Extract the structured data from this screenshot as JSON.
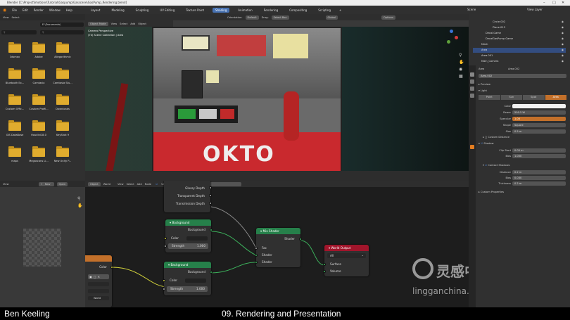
{
  "window": {
    "title": "Blender [C:\\Project\\Imotions\\Tutorial\\Gaspump\\Gasscene\\GasPump_Rendering.blend]"
  },
  "menu": [
    "File",
    "Edit",
    "Render",
    "Window",
    "Help"
  ],
  "workspaces": [
    "Layout",
    "Modeling",
    "Sculpting",
    "UV Editing",
    "Texture Paint",
    "Shading",
    "Animation",
    "Rendering",
    "Compositing",
    "Scripting"
  ],
  "active_workspace": "Shading",
  "scene": {
    "scene_label": "Scene",
    "view_layer_label": "View Layer"
  },
  "file_browser": {
    "menu": [
      "View",
      "Select"
    ],
    "path": "E:\\Documents\\",
    "folders": [
      "3dsmax",
      "Adobe",
      "Allegorithmic",
      "Bluetooth Ex...",
      "Camtasia",
      "Camtasia Stu...",
      "Custom Offic...",
      "Custom Profil...",
      "Downloads",
      "GIS DataBase",
      "Houdini18.0",
      "KeyShot 9",
      "maps",
      "Megascans Li...",
      "New Unity P..."
    ]
  },
  "viewport": {
    "header": [
      "Object Mode",
      "View",
      "Select",
      "Add",
      "Object"
    ],
    "orientation_label": "Orientation:",
    "orientation_value": "Default",
    "drag_label": "Drag:",
    "drag_value": "Select Box",
    "transform_value": "Global",
    "options_label": "Options",
    "overlay_line1": "Camera Perspective",
    "overlay_line2": "(74) Scene Collection | Area",
    "pump_text": "OKTO"
  },
  "image_editor": {
    "menu": [
      "View"
    ],
    "new_label": "New",
    "open_label": "Open"
  },
  "node_editor": {
    "header": [
      "Object",
      "View",
      "Select",
      "Add",
      "Node"
    ],
    "use_nodes": "Use Nodes",
    "world_label": "World",
    "world_name": "World",
    "partial_node_rows": [
      "Glossy Depth",
      "Transparent Depth",
      "Transmission Depth"
    ],
    "background1": {
      "title": "Background",
      "output": "Background",
      "color": "Color",
      "strength_label": "Strength",
      "strength": "1.000"
    },
    "background2": {
      "title": "Background",
      "output": "Background",
      "color": "Color",
      "strength_label": "Strength",
      "strength": "1.000"
    },
    "mix": {
      "title": "Mix Shader",
      "output": "Shader",
      "fac": "Fac",
      "in1": "Shader",
      "in2": "Shader"
    },
    "output": {
      "title": "World Output",
      "target": "All",
      "surface": "Surface",
      "volume": "Volume"
    },
    "left_node": {
      "output": "Color",
      "dropdown": "World"
    }
  },
  "outliner": {
    "rows": [
      "Circle.002",
      "Plane.013",
      "Decal.Game",
      "DecalGasPump.Game",
      "Mesh",
      "Area",
      "Area.001",
      "Main_Camera"
    ]
  },
  "properties": {
    "object_name": "Area",
    "data_name": "Area.002",
    "datablock": "Area.002",
    "preview": "Preview",
    "light": "Light",
    "light_types": [
      "Point",
      "Sun",
      "Spot",
      "Area"
    ],
    "active_type": "Area",
    "fields": [
      {
        "label": "Color",
        "value": ""
      },
      {
        "label": "Power",
        "value": "500.5 W"
      },
      {
        "label": "Specular",
        "value": "1.00"
      },
      {
        "label": "Shape",
        "value": "Square"
      },
      {
        "label": "Size",
        "value": "0.5 m"
      }
    ],
    "custom_distance": "Custom Distance",
    "shadow": "Shadow",
    "shadow_fields": [
      {
        "label": "Clip Start",
        "value": "0.05 m"
      },
      {
        "label": "Bias",
        "value": "1.000"
      }
    ],
    "contact_shadows": "Contact Shadows",
    "contact_fields": [
      {
        "label": "Distance",
        "value": "0.2 m"
      },
      {
        "label": "Bias",
        "value": "0.030"
      },
      {
        "label": "Thickness",
        "value": "0.2 m"
      }
    ],
    "custom_properties": "Custom Properties"
  },
  "caption": {
    "left": "Ben Keeling",
    "center": "09. Rendering and Presentation"
  },
  "watermark": {
    "cn": "灵感中国",
    "url": "lingganchina.com"
  },
  "colors": {
    "accent": "#4772b3",
    "node_green": "#26804a",
    "node_red": "#a1152b",
    "orange": "#c3702a",
    "folder": "#e0ac2e"
  }
}
